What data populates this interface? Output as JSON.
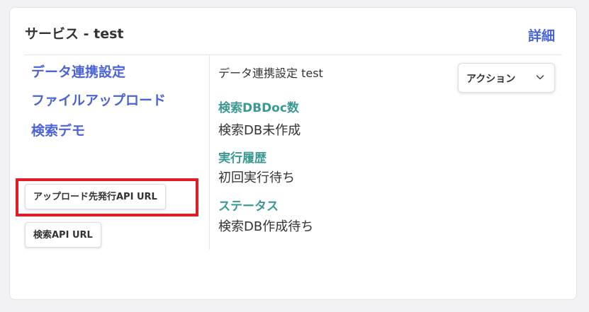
{
  "card": {
    "title": "サービス - test",
    "detail_link": "詳細"
  },
  "nav": {
    "items": [
      {
        "label": "データ連携設定"
      },
      {
        "label": "ファイルアップロード"
      },
      {
        "label": "検索デモ"
      }
    ]
  },
  "buttons": {
    "upload_api_url": "アップロード先発行API URL",
    "search_api_url": "検索API URL"
  },
  "detail": {
    "heading": "データ連携設定 test",
    "action_label": "アクション",
    "fields": [
      {
        "label": "検索DBDoc数",
        "value": "検索DB未作成"
      },
      {
        "label": "実行履歴",
        "value": "初回実行待ち"
      },
      {
        "label": "ステータス",
        "value": "検索DB作成待ち"
      }
    ]
  },
  "colors": {
    "link": "#4a63d6",
    "field_label": "#3a9a93",
    "highlight": "#e01d24"
  },
  "icons": {
    "action_chevron": "chevron-down-icon"
  }
}
